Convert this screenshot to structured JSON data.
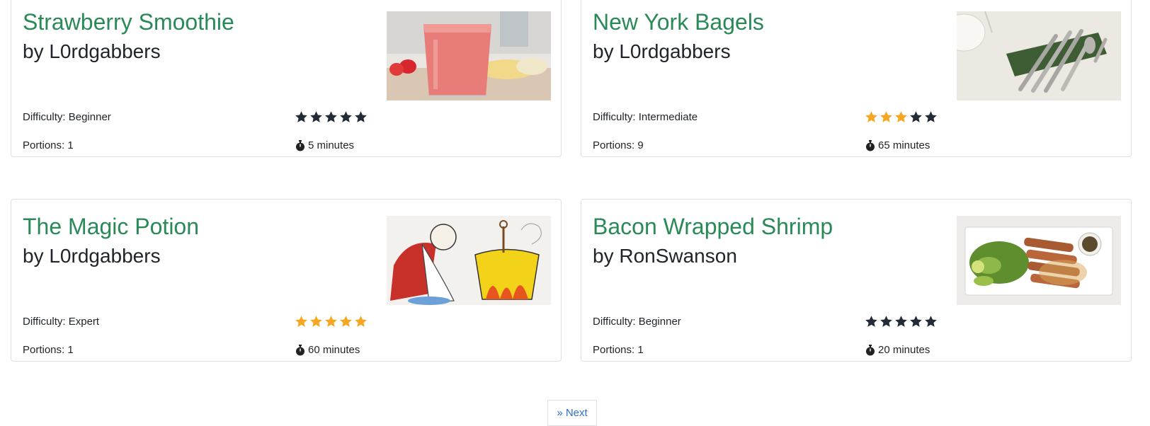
{
  "colors": {
    "title": "#2a8a57",
    "star_filled": "#f5a623",
    "star_empty": "#222b36",
    "link": "#2f6fcf"
  },
  "recipes": [
    {
      "title": "Strawberry Smoothie",
      "author": "by L0rdgabbers",
      "difficulty": "Difficulty: Beginner",
      "portions": "Portions: 1",
      "rating": 0,
      "time": "5 minutes",
      "image": "strawberry-smoothie-photo"
    },
    {
      "title": "New York Bagels",
      "author": "by L0rdgabbers",
      "difficulty": "Difficulty: Intermediate",
      "portions": "Portions: 9",
      "rating": 3,
      "time": "65 minutes",
      "image": "cutlery-photo"
    },
    {
      "title": "The Magic Potion",
      "author": "by L0rdgabbers",
      "difficulty": "Difficulty: Expert",
      "portions": "Portions: 1",
      "rating": 5,
      "time": "60 minutes",
      "image": "druid-cauldron-illustration"
    },
    {
      "title": "Bacon Wrapped Shrimp",
      "author": "by RonSwanson",
      "difficulty": "Difficulty: Beginner",
      "portions": "Portions: 1",
      "rating": 0,
      "time": "20 minutes",
      "image": "bacon-wrapped-shrimp-photo"
    }
  ],
  "pagination": {
    "next_label": "» Next"
  }
}
